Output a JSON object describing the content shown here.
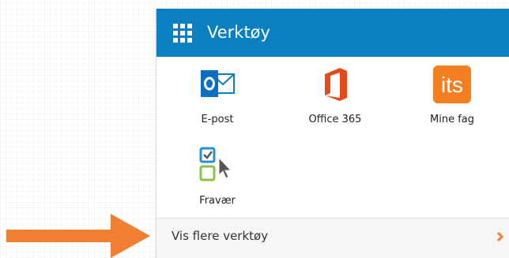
{
  "panel": {
    "title": "Verktøy",
    "tools": [
      {
        "label": "E-post",
        "icon": "outlook-mail-icon"
      },
      {
        "label": "Office 365",
        "icon": "office-365-icon"
      },
      {
        "label": "Mine fag",
        "icon": "its-learning-icon",
        "icon_text": "its"
      },
      {
        "label": "Fravær",
        "icon": "absence-checklist-icon"
      }
    ],
    "more_label": "Vis flere verktøy"
  },
  "colors": {
    "header_blue": "#0a7fc2",
    "office_orange": "#e64a19",
    "its_orange": "#f47f20",
    "arrow_orange": "#f07f32",
    "check_blue": "#2a8fd1",
    "check_green": "#8bc34a"
  }
}
